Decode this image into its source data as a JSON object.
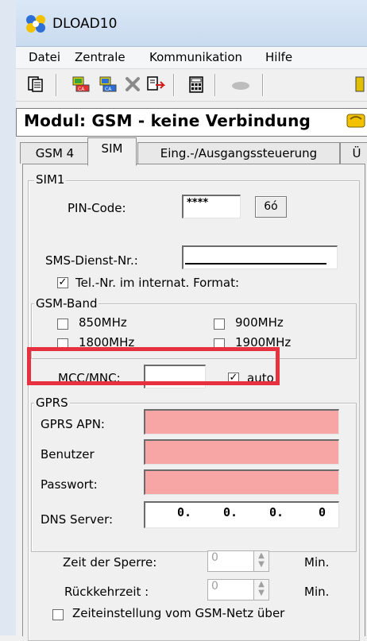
{
  "window": {
    "title": "DLOAD10"
  },
  "menu": [
    "Datei",
    "Zentrale",
    "Kommunikation",
    "Hilfe"
  ],
  "toolbar": {
    "icons": [
      "copy-icon",
      "module-read-icon",
      "module-write-icon",
      "delete-icon",
      "export-icon",
      "calculator-icon",
      "disabled-icon",
      "phone-icon"
    ]
  },
  "module": {
    "status": "Modul: GSM - keine Verbindung"
  },
  "tabs": {
    "gsm4": "GSM 4",
    "sim": "SIM",
    "io": "Eing.-/Ausgangssteuerung",
    "more": "Ü"
  },
  "sim1": {
    "group_label": "SIM1",
    "pin_label": "PIN-Code:",
    "pin_value": "****",
    "pin_button": "6ó",
    "sms_label": "SMS-Dienst-Nr.:",
    "sms_value": "",
    "intl_format_label": "Tel.-Nr. im internat. Format:",
    "intl_format_checked": true
  },
  "gsm_band": {
    "group_label": "GSM-Band",
    "b850": "850MHz",
    "b900": "900MHz",
    "b1800": "1800MHz",
    "b1900": "1900MHz"
  },
  "mcc": {
    "label": "MCC/MNC:",
    "value": "",
    "auto_label": "auto",
    "auto_checked": true
  },
  "gprs": {
    "group_label": "GPRS",
    "apn_label": "GPRS APN:",
    "user_label": "Benutzer",
    "pass_label": "Passwort:",
    "dns_label": "DNS Server:",
    "dns": [
      "0.",
      "0.",
      "0.",
      "0"
    ]
  },
  "timing": {
    "lock_label": "Zeit der Sperre:",
    "lock_value": "0",
    "lock_unit": "Min.",
    "return_label": "Rückkehrzeit :",
    "return_value": "0",
    "return_unit": "Min."
  },
  "gsm_time": {
    "label": "Zeiteinstellung vom GSM-Netz über",
    "checked": false
  },
  "colors": {
    "highlight": "#e8313f",
    "error_field": "#f8a5a5"
  }
}
